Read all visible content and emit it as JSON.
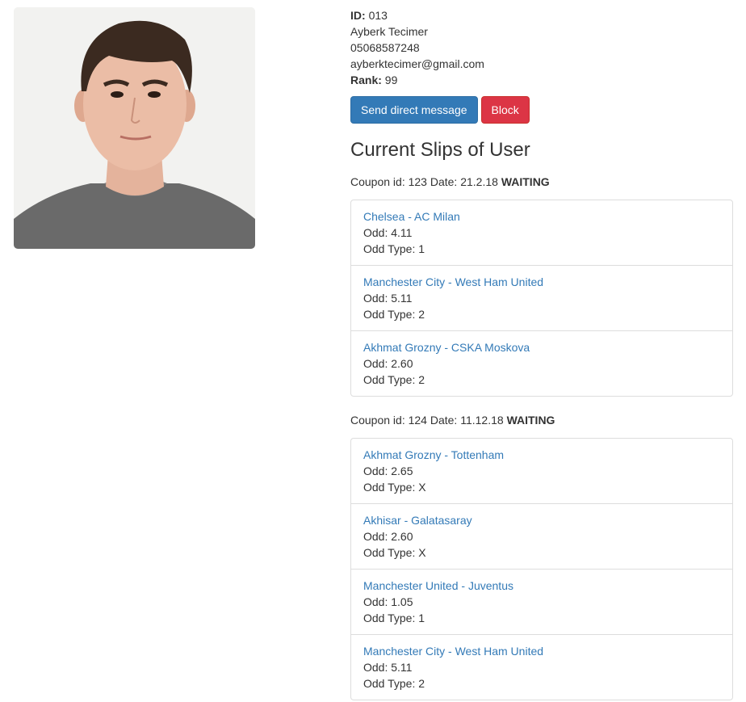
{
  "profile": {
    "id_label": "ID:",
    "id_value": "013",
    "name": "Ayberk Tecimer",
    "phone": "05068587248",
    "email": "ayberktecimer@gmail.com",
    "rank_label": "Rank:",
    "rank_value": "99"
  },
  "actions": {
    "send_message_label": "Send direct message",
    "block_label": "Block"
  },
  "slips_title": "Current Slips of User",
  "coupons": [
    {
      "id_label": "Coupon id: 123 Date: 21.2.18",
      "status": "WAITING",
      "matches": [
        {
          "name": "Chelsea - AC Milan",
          "odd": "Odd: 4.11",
          "odd_type": "Odd Type: 1"
        },
        {
          "name": "Manchester City - West Ham United",
          "odd": "Odd: 5.11",
          "odd_type": "Odd Type: 2"
        },
        {
          "name": "Akhmat Grozny - CSKA Moskova",
          "odd": "Odd: 2.60",
          "odd_type": "Odd Type: 2"
        }
      ]
    },
    {
      "id_label": "Coupon id: 124 Date: 11.12.18",
      "status": "WAITING",
      "matches": [
        {
          "name": "Akhmat Grozny - Tottenham",
          "odd": "Odd: 2.65",
          "odd_type": "Odd Type: X"
        },
        {
          "name": "Akhisar - Galatasaray",
          "odd": "Odd: 2.60",
          "odd_type": "Odd Type: X"
        },
        {
          "name": "Manchester United - Juventus",
          "odd": "Odd: 1.05",
          "odd_type": "Odd Type: 1"
        },
        {
          "name": "Manchester City - West Ham United",
          "odd": "Odd: 5.11",
          "odd_type": "Odd Type: 2"
        }
      ]
    }
  ],
  "colors": {
    "primary": "#337ab7",
    "danger": "#dc3545",
    "link": "#337ab7",
    "border": "#dddddd",
    "text": "#333333"
  }
}
